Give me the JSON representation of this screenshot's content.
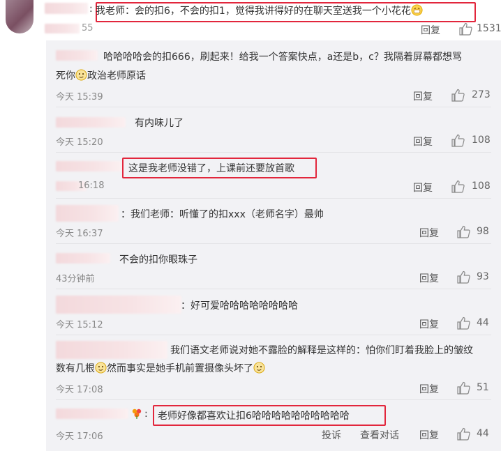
{
  "top_comment": {
    "text_before": "我老师：会的扣6，不会的扣1，觉得我讲得好的在聊天室送我一个小花花",
    "time_fragment": "55",
    "reply_label": "回复",
    "likes": "1531",
    "emoji_icon": "grin-emoji-icon"
  },
  "replies": [
    {
      "text1": "哈哈哈哈会的扣666，刷起来！给我一个答案快点，a还是b，c？我隔着屏幕都想骂",
      "text2": "死你",
      "text3": "政治老师原话",
      "time": "今天 15:39",
      "reply_label": "回复",
      "likes": "273"
    },
    {
      "text": "有内味儿了",
      "time": "今天 15:20",
      "reply_label": "回复",
      "likes": "108"
    },
    {
      "text": "这是我老师没错了，上课前还要放首歌",
      "time_fragment": "16:18",
      "reply_label": "回复",
      "likes": "108"
    },
    {
      "text": "：我们老师：听懂了的扣xxx（老师名字）最帅",
      "time": "今天 16:37",
      "reply_label": "回复",
      "likes": "98"
    },
    {
      "text": "不会的扣你眼珠子",
      "time": "43分钟前",
      "reply_label": "回复",
      "likes": "93"
    },
    {
      "text": "：好可爱哈哈哈哈哈哈哈哈",
      "time": "今天 15:12",
      "reply_label": "回复",
      "likes": "44"
    },
    {
      "text1": "我们语文老师说对她不露脸的解释是这样的：怕你们盯着我脸上的皱纹",
      "text2": "数有几根",
      "text3": "然而事实是她手机前置摄像头坏了",
      "time": "今天 17:08",
      "reply_label": "回复",
      "likes": "51"
    },
    {
      "text": "老师好像都喜欢让扣6哈哈哈哈哈哈哈哈哈哈",
      "time": "今天 17:06",
      "report_label": "投诉",
      "view_conv_label": "查看对话",
      "reply_label": "回复",
      "likes": "44"
    }
  ],
  "colors": {
    "highlight_box": "#e2263c",
    "reply_panel_bg": "#f2f2f5",
    "meta_text": "#888888"
  }
}
